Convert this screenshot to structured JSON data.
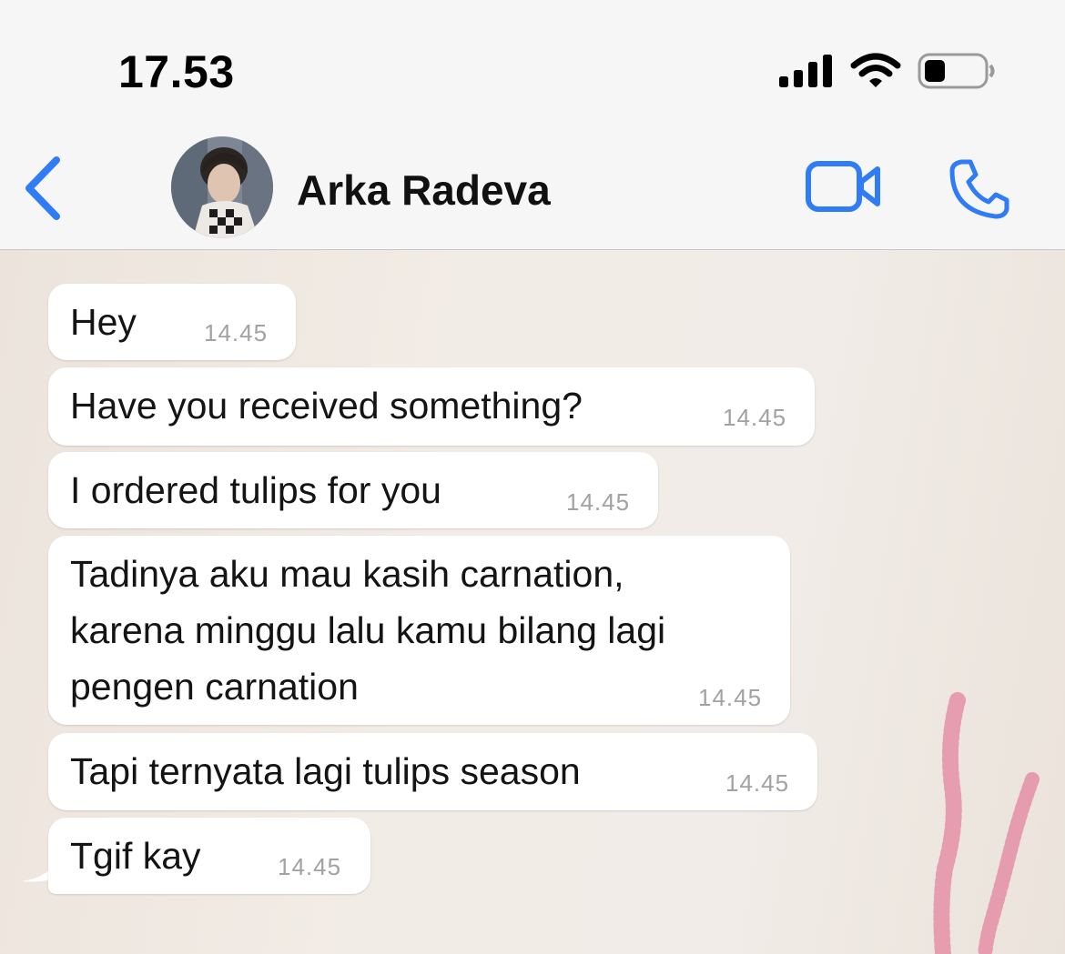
{
  "status_bar": {
    "time": "17.53"
  },
  "header": {
    "contact_name": "Arka Radeva",
    "icons": {
      "back": "chevron-left-icon",
      "video": "video-camera-icon",
      "call": "phone-icon"
    },
    "accent_color": "#2f7cf6"
  },
  "messages": [
    {
      "text": "Hey",
      "time": "14.45"
    },
    {
      "text": "Have you received something?",
      "time": "14.45"
    },
    {
      "text": "I ordered tulips for you",
      "time": "14.45"
    },
    {
      "text": "Tadinya aku mau kasih carnation,\nkarena minggu lalu kamu bilang lagi\npengen carnation",
      "time": "14.45"
    },
    {
      "text": "Tapi ternyata lagi tulips season",
      "time": "14.45"
    },
    {
      "text": "Tgif kay",
      "time": "14.45"
    }
  ]
}
